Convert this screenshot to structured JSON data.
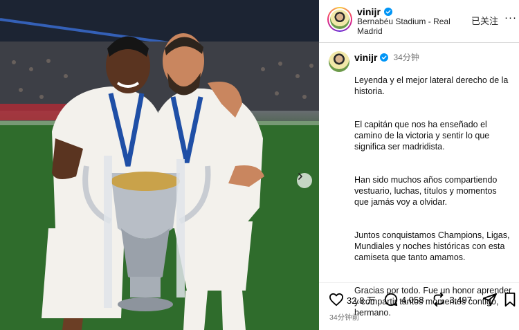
{
  "post": {
    "username": "vinijr",
    "location": "Bernabéu Stadium - Real Madrid",
    "follow_state": "已关注",
    "more_label": "···"
  },
  "caption": {
    "username": "vinijr",
    "time": "34分钟",
    "paragraphs": [
      "Leyenda y el mejor lateral derecho de la historia.",
      "El capitán que nos ha enseñado el camino de la victoria y sentir lo que significa ser madridista.",
      "Han sido muchos años compartiendo vestuario, luchas, títulos y momentos que jamás voy a olvidar.",
      "Juntos conquistamos Champions, Ligas, Mundiales y noches históricas con esta camiseta que tanto amamos.",
      "Gracias por todo. Fue un honor aprender y compartir tantos momentos contigo, hermano."
    ]
  },
  "actions": {
    "likes": "32.8 万",
    "comments": "4,058",
    "reposts": "3,497"
  },
  "footer": {
    "timestamp": "34分钟前"
  },
  "icons": {
    "like": "heart-icon",
    "comment": "comment-bubble-icon",
    "repost": "repost-icon",
    "share": "send-icon",
    "save": "bookmark-icon",
    "verified": "verified-badge-icon",
    "next": "chevron-right-icon"
  },
  "colors": {
    "verified": "#0095f6",
    "secondary_text": "#737373",
    "border": "#dbdbdb"
  }
}
